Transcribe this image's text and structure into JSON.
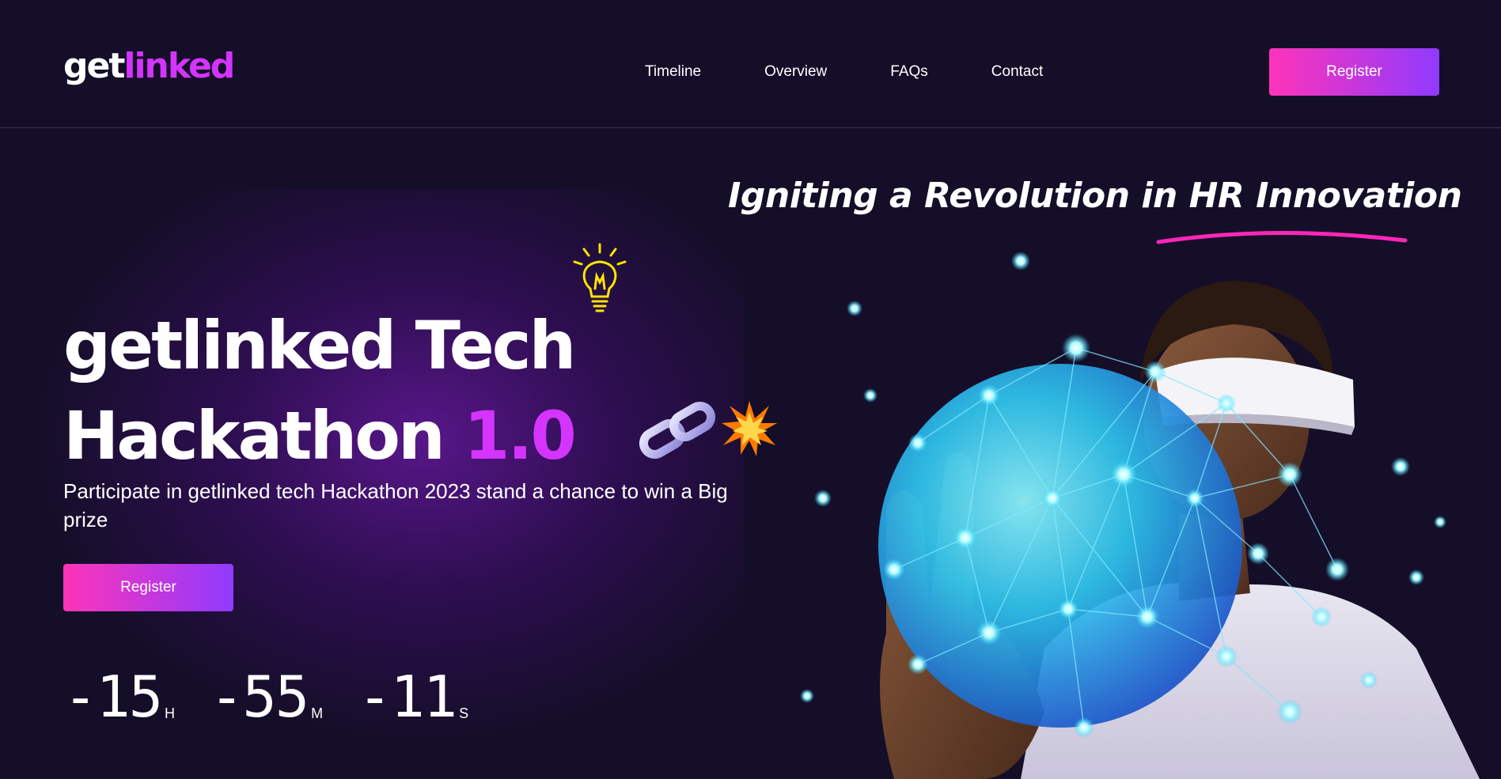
{
  "header": {
    "logo_part1": "get",
    "logo_part2": "linked",
    "nav": [
      "Timeline",
      "Overview",
      "FAQs",
      "Contact"
    ],
    "register_label": "Register"
  },
  "hero": {
    "tagline": "Igniting a Revolution in HR Innovation",
    "headline_line1": "getlinked Tech",
    "headline_line2": "Hackathon",
    "headline_accent": "1.0",
    "subtitle": "Participate in getlinked tech Hackathon 2023 stand a chance to win a Big prize",
    "register_label": "Register",
    "countdown": {
      "hours": "-15",
      "hours_label": "H",
      "minutes": "-55",
      "minutes_label": "M",
      "seconds": "-11",
      "seconds_label": "S"
    }
  },
  "colors": {
    "background": "#150e28",
    "accent": "#d434fe",
    "button_gradient_start": "#fe34b9",
    "button_gradient_end": "#903aff",
    "underline": "#ff26b9"
  },
  "icons": {
    "bulb": "lightbulb-icon",
    "chain": "chain-link-icon",
    "spark": "explosion-icon"
  }
}
